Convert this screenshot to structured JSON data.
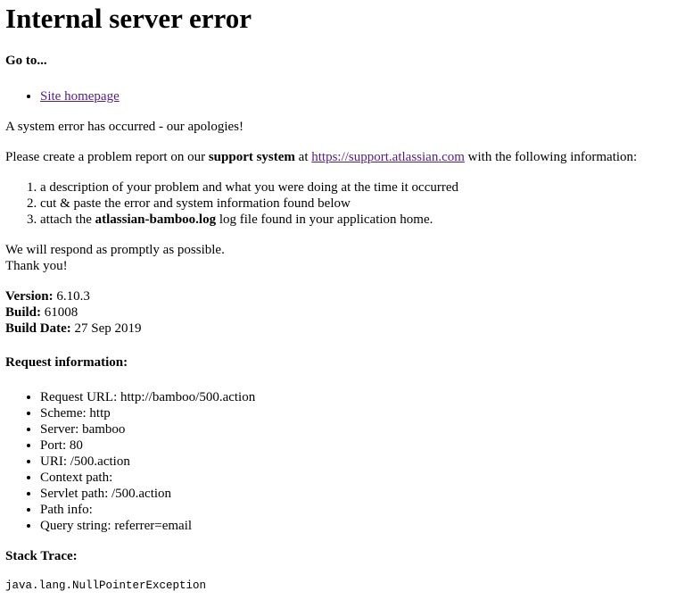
{
  "page": {
    "title": "Internal server error",
    "goto_heading": "Go to...",
    "links": [
      {
        "label": "Site homepage"
      }
    ],
    "apology": "A system error has occurred - our apologies!",
    "report": {
      "prefix": "Please create a problem report on our ",
      "system_bold": "support system",
      "middle": " at ",
      "support_url": "https://support.atlassian.com",
      "suffix": " with the following information:"
    },
    "steps": {
      "step1": "a description of your problem and what you were doing at the time it occurred",
      "step2": "cut & paste the error and system information found below",
      "step3_prefix": "attach the ",
      "step3_bold": "atlassian-bamboo.log",
      "step3_suffix": " log file found in your application home."
    },
    "respond_line": "We will respond as promptly as possible.",
    "thanks_line": "Thank you!",
    "version_info": {
      "version_label": "Version:",
      "version_value": " 6.10.3",
      "build_label": "Build:",
      "build_value": " 61008",
      "build_date_label": "Build Date:",
      "build_date_value": " 27 Sep 2019"
    },
    "request_heading": "Request information:",
    "request_items": [
      "Request URL: http://bamboo/500.action",
      "Scheme: http",
      "Server: bamboo",
      "Port: 80",
      "URI: /500.action",
      "Context path:",
      "Servlet path: /500.action",
      "Path info:",
      "Query string: referrer=email"
    ],
    "stack_heading": "Stack Trace:",
    "stack_trace": "java.lang.NullPointerException"
  }
}
